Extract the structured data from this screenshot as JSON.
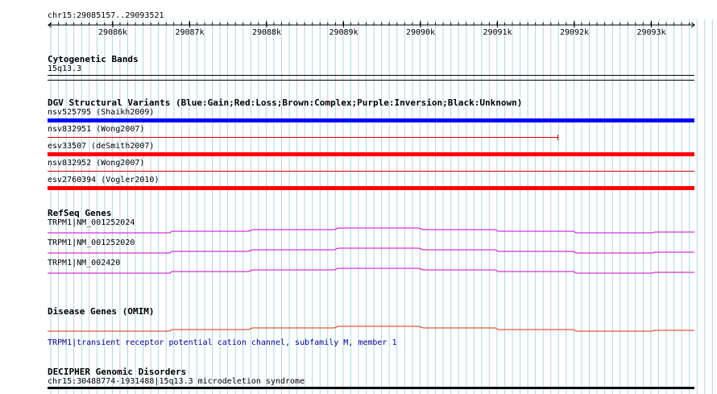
{
  "ruler": {
    "region": "chr15:29085157..29093521",
    "ticks": [
      "29086k",
      "29087k",
      "29088k",
      "29089k",
      "29090k",
      "29091k",
      "29092k",
      "29093k"
    ]
  },
  "cytoband": {
    "title": "Cytogenetic Bands",
    "band": "15q13.3"
  },
  "dgv": {
    "title": "DGV Structural Variants (Blue:Gain;Red:Loss;Brown:Complex;Purple:Inversion;Black:Unknown)",
    "variants": [
      {
        "label": "nsv525795 (Shaikh2009)",
        "color": "#0000ff"
      },
      {
        "label": "nsv832951 (Wong2007)",
        "color": "#dd0000"
      },
      {
        "label": "esv33507 (deSmith2007)",
        "color": "#ff0000"
      },
      {
        "label": "nsv832952 (Wong2007)",
        "color": "#dd0000"
      },
      {
        "label": "esv2760394 (Vogler2010)",
        "color": "#ff0000"
      }
    ]
  },
  "refseq": {
    "title": "RefSeq Genes",
    "genes": [
      {
        "label": "TRPM1|NM_001252024",
        "color": "#cc00cc"
      },
      {
        "label": "TRPM1|NM_001252020",
        "color": "#cc00cc"
      },
      {
        "label": "TRPM1|NM_002420",
        "color": "#cc00cc"
      }
    ]
  },
  "omim": {
    "title": "Disease Genes (OMIM)",
    "gene": "TRPM1|transient receptor potential cation channel, subfamily M, member 1",
    "color": "#dd3300"
  },
  "decipher": {
    "title": "DECIPHER Genomic Disorders",
    "item": "chr15:30488774-1931488|15q13.3 microdeletion syndrome"
  },
  "colors": {
    "grid": "#a8d8e8",
    "gain": "#0000ff",
    "loss": "#ff0000",
    "gene": "#cc00cc",
    "omim": "#dd3300"
  }
}
